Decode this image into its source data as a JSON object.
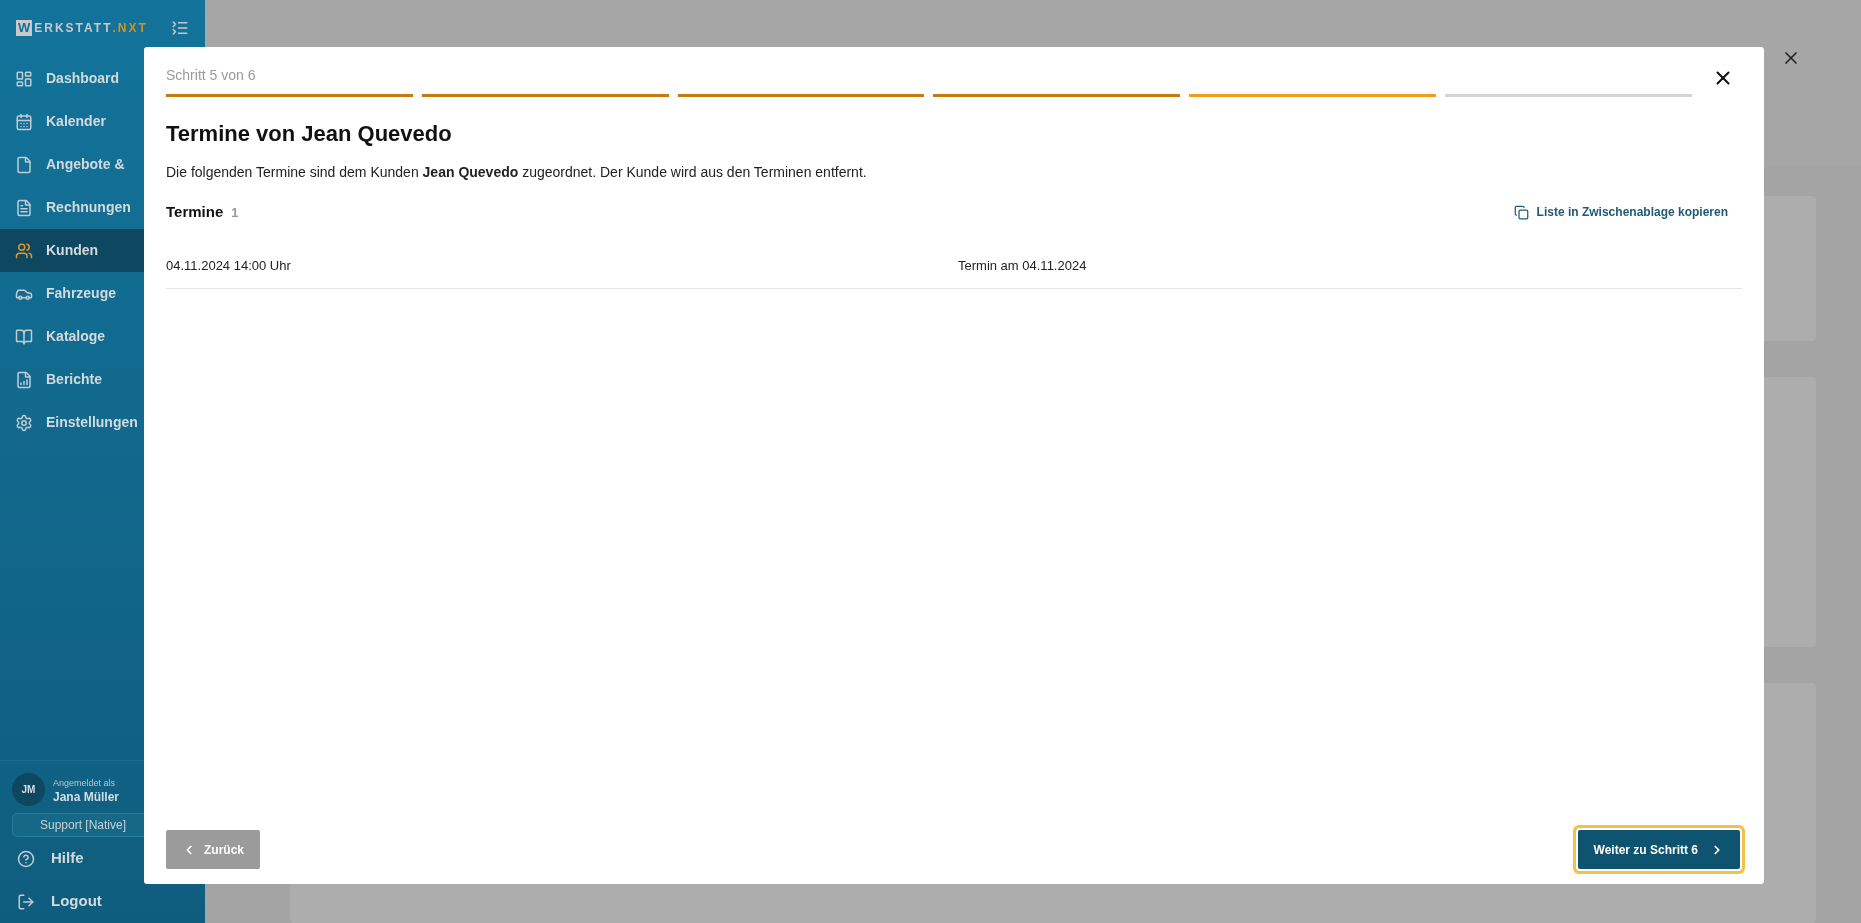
{
  "sidebar": {
    "logo": {
      "mark": "W",
      "name": "ERKSTATT",
      "suffix": ".NXT"
    },
    "items": [
      {
        "label": "Dashboard",
        "selected": false
      },
      {
        "label": "Kalender",
        "selected": false
      },
      {
        "label": "Angebote &",
        "selected": false
      },
      {
        "label": "Rechnungen",
        "selected": false
      },
      {
        "label": "Kunden",
        "selected": true
      },
      {
        "label": "Fahrzeuge",
        "selected": false
      },
      {
        "label": "Kataloge",
        "selected": false
      },
      {
        "label": "Berichte",
        "selected": false
      },
      {
        "label": "Einstellungen",
        "selected": false
      }
    ],
    "user": {
      "initials": "JM",
      "caption": "Angemeldet als",
      "name": "Jana Müller"
    },
    "support": "Support [Native]",
    "bottom_items": [
      {
        "label": "Hilfe"
      },
      {
        "label": "Logout"
      }
    ]
  },
  "modal": {
    "step_label": "Schritt 5 von 6",
    "steps": [
      {
        "done": true,
        "selected": false
      },
      {
        "done": true,
        "selected": false
      },
      {
        "done": true,
        "selected": false
      },
      {
        "done": true,
        "selected": false
      },
      {
        "done": false,
        "selected": true
      },
      {
        "done": false,
        "selected": false
      }
    ],
    "title": "Termine von Jean Quevedo",
    "description": "Die folgenden Termine sind dem Kunden **Jean Quevedo** zugeordnet. Der Kunde wird aus den Terminen entfernt.",
    "section_title": "Termine",
    "section_count": "1",
    "copy_link": "Liste in Zwischenablage kopieren",
    "rows": [
      {
        "date": "04.11.2024 14:00 Uhr",
        "label": "Termin am 04.11.2024"
      }
    ],
    "back_button": "Zurück",
    "next_button": "Weiter zu Schritt 6"
  }
}
